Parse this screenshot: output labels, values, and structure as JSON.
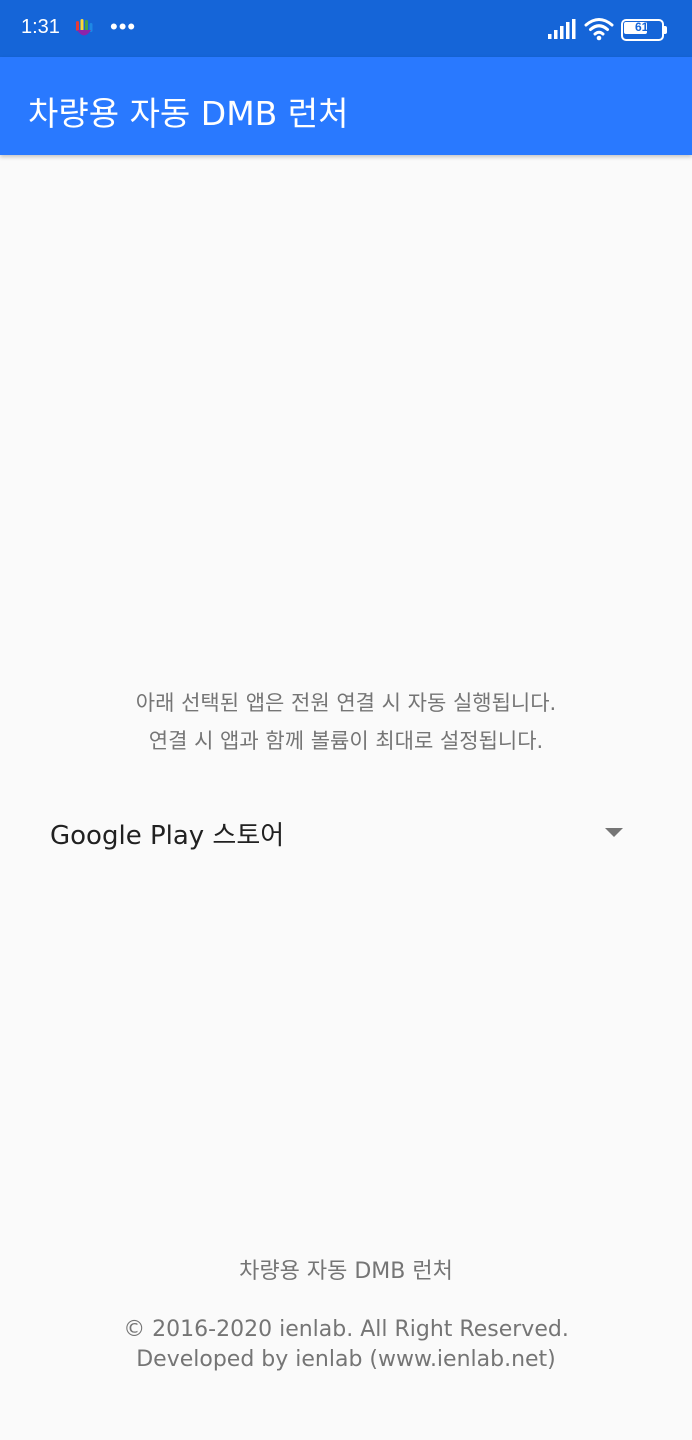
{
  "status_bar": {
    "time": "1:31",
    "dots": "•••",
    "battery_level": "61",
    "background_color": "#1565d8",
    "icons": [
      "app-notification-icon",
      "signal-icon",
      "wifi-icon",
      "battery-icon"
    ]
  },
  "app_bar": {
    "title": "차량용 자동 DMB 런처",
    "background_color": "#2979ff"
  },
  "main": {
    "description_lines": [
      "아래 선택된 앱은 전원 연결 시 자동 실행됩니다.",
      "연결 시 앱과 함께 볼륨이 최대로 설정됩니다."
    ],
    "app_selector": {
      "selected_value": "Google Play 스토어",
      "icon": "dropdown-arrow-icon"
    }
  },
  "footer": {
    "app_name": "차량용 자동 DMB 런처",
    "copyright": "© 2016-2020 ienlab. All Right Reserved.",
    "developer": "Developed by ienlab (www.ienlab.net)"
  }
}
